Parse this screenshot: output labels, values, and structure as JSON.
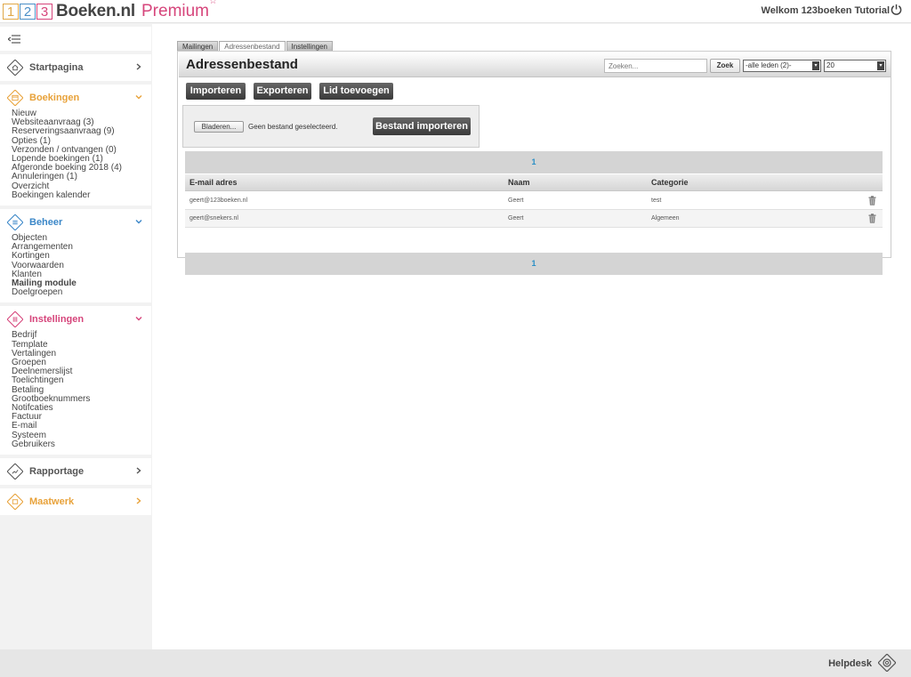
{
  "header": {
    "logo": {
      "d1": "1",
      "d2": "2",
      "d3": "3",
      "brand": "Boeken.nl",
      "premium": "Premium",
      "star": "☆"
    },
    "welcome": "Welkom 123boeken Tutorial"
  },
  "sidebar": {
    "sections": {
      "start": {
        "title": "Startpagina"
      },
      "boekingen": {
        "title": "Boekingen",
        "items": [
          "Nieuw",
          "Websiteaanvraag (3)",
          "Reserveringsaanvraag (9)",
          "Opties (1)",
          "Verzonden / ontvangen (0)",
          "Lopende boekingen (1)",
          "Afgeronde boeking 2018 (4)",
          "Annuleringen (1)",
          "Overzicht",
          "Boekingen kalender"
        ]
      },
      "beheer": {
        "title": "Beheer",
        "items": [
          "Objecten",
          "Arrangementen",
          "Kortingen",
          "Voorwaarden",
          "Klanten",
          "Mailing module",
          "Doelgroepen"
        ]
      },
      "instellingen": {
        "title": "Instellingen",
        "items": [
          "Bedrijf",
          "Template",
          "Vertalingen",
          "Groepen",
          "Deelnemerslijst",
          "Toelichtingen",
          "Betaling",
          "Grootboeknummers",
          "Notifcaties",
          "Factuur",
          "E-mail",
          "Systeem",
          "Gebruikers"
        ]
      },
      "rapportage": {
        "title": "Rapportage"
      },
      "maatwerk": {
        "title": "Maatwerk"
      }
    }
  },
  "main": {
    "tabs": [
      "Mailingen",
      "Adressenbestand",
      "Instellingen"
    ],
    "title": "Adressenbestand",
    "search_placeholder": "Zoeken...",
    "search_button": "Zoek",
    "filter_select": "-alle leden (2)-",
    "per_page_select": "20",
    "buttons": {
      "import": "Importeren",
      "export": "Exporteren",
      "add_member": "Lid toevoegen"
    },
    "upload": {
      "browse": "Bladeren...",
      "no_file": "Geen bestand geselecteerd.",
      "submit": "Bestand importeren"
    },
    "pager": "1",
    "columns": [
      "E-mail adres",
      "Naam",
      "Categorie"
    ],
    "rows": [
      {
        "email": "geert@123boeken.nl",
        "name": "Geert",
        "category": "test"
      },
      {
        "email": "geert@snekers.nl",
        "name": "Geert",
        "category": "Algemeen"
      }
    ]
  },
  "footer": {
    "helpdesk": "Helpdesk"
  },
  "colors": {
    "orange": "#e8a23a",
    "blue": "#3b87c8",
    "pink": "#d6457b",
    "link_blue": "#2a8fc6"
  }
}
